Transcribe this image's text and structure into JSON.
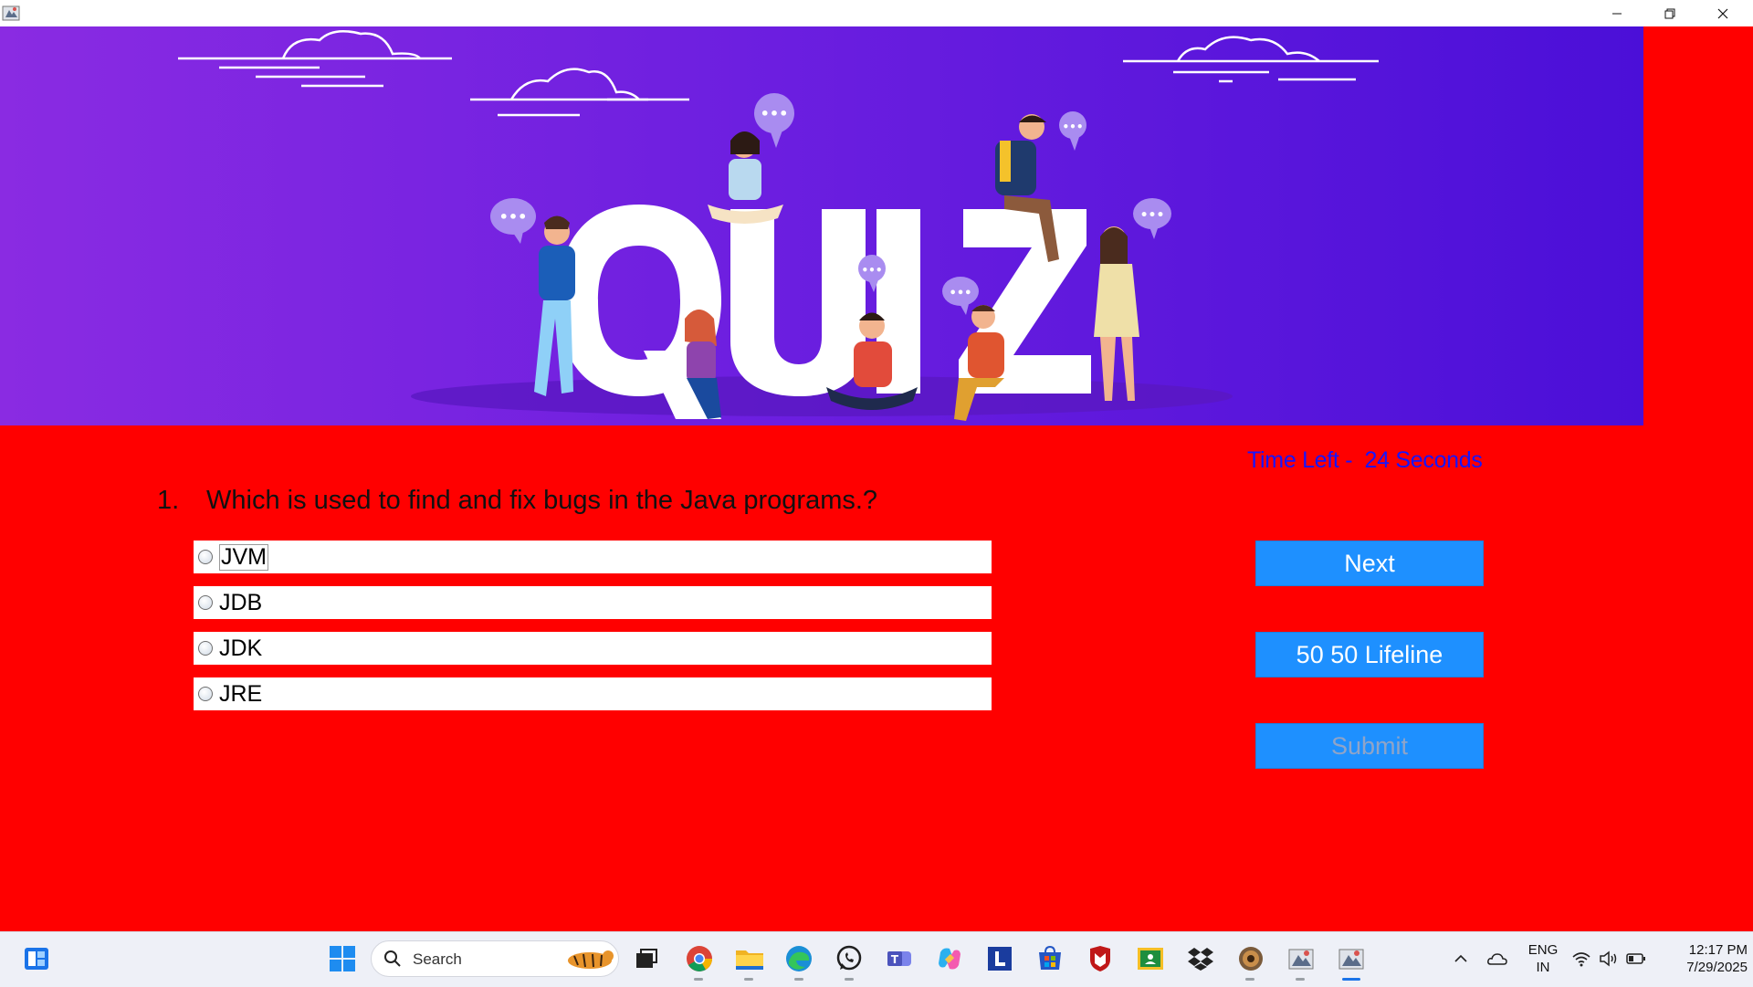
{
  "window": {
    "minimize_icon": "minimize-icon",
    "restore_icon": "restore-icon",
    "close_icon": "close-icon"
  },
  "banner": {
    "title": "QUIZ",
    "chat_bubble": "•••"
  },
  "timer": {
    "text": "Time Left -  24 Seconds"
  },
  "question": {
    "number": "1.",
    "text": "Which is used to find and fix bugs in the Java programs.?"
  },
  "options": [
    {
      "label": "JVM",
      "selected": false
    },
    {
      "label": "JDB",
      "selected": false
    },
    {
      "label": "JDK",
      "selected": false
    },
    {
      "label": "JRE",
      "selected": false
    }
  ],
  "buttons": {
    "next": "Next",
    "lifeline": "50 50 Lifeline",
    "submit": "Submit"
  },
  "taskbar": {
    "search_placeholder": "Search",
    "language_line1": "ENG",
    "language_line2": "IN",
    "time": "12:17 PM",
    "date": "7/29/2025"
  },
  "colors": {
    "background": "#ff0000",
    "banner_start": "#8a2be2",
    "banner_end": "#4b0fd8",
    "timer_text": "#1515ff",
    "button": "#1e90ff"
  }
}
